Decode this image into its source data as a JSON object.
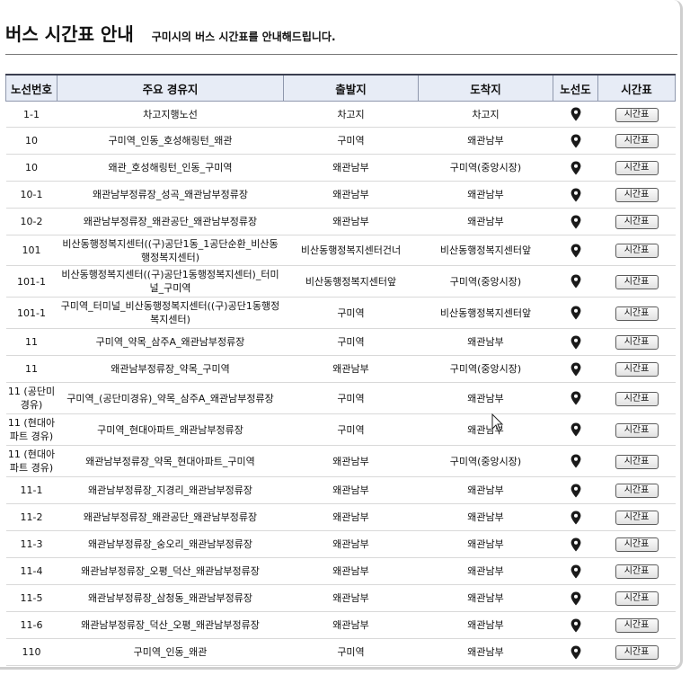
{
  "header": {
    "title": "버스 시간표 안내",
    "subtitle": "구미시의 버스 시간표를 안내해드립니다."
  },
  "table": {
    "columns": [
      "노선번호",
      "주요 경유지",
      "출발지",
      "도착지",
      "노선도",
      "시간표"
    ],
    "button_label": "시간표",
    "rows": [
      {
        "route": "1-1",
        "via": "차고지행노선",
        "from": "차고지",
        "to": "차고지",
        "h": 29
      },
      {
        "route": "10",
        "via": "구미역_인동_호성해링턴_왜관",
        "from": "구미역",
        "to": "왜관남부",
        "h": 30
      },
      {
        "route": "10",
        "via": "왜관_호성해링턴_인동_구미역",
        "from": "왜관남부",
        "to": "구미역(중앙시장)",
        "h": 30
      },
      {
        "route": "10-1",
        "via": "왜관남부정류장_성곡_왜관남부정류장",
        "from": "왜관남부",
        "to": "왜관남부",
        "h": 30
      },
      {
        "route": "10-2",
        "via": "왜관남부정류장_왜관공단_왜관남부정류장",
        "from": "왜관남부",
        "to": "왜관남부",
        "h": 30
      },
      {
        "route": "101",
        "via": "비산동행정복지센터((구)공단1동_1공단순환_비산동행정복지센터)",
        "from": "비산동행정복지센터건너",
        "to": "비산동행정복지센터앞",
        "h": 34
      },
      {
        "route": "101-1",
        "via": "비산동행정복지센터((구)공단1동행정복지센터)_터미널_구미역",
        "from": "비산동행정복지센터앞",
        "to": "구미역(중앙시장)",
        "h": 35
      },
      {
        "route": "101-1",
        "via": "구미역_터미널_비산동행정복지센터((구)공단1동행정복지센터)",
        "from": "구미역",
        "to": "비산동행정복지센터앞",
        "h": 35
      },
      {
        "route": "11",
        "via": "구미역_약목_삼주A_왜관남부정류장",
        "from": "구미역",
        "to": "왜관남부",
        "h": 30
      },
      {
        "route": "11",
        "via": "왜관남부정류장_약목_구미역",
        "from": "왜관남부",
        "to": "구미역(중앙시장)",
        "h": 30
      },
      {
        "route": "11 (공단미경유)",
        "via": "구미역_(공단미경유)_약목_삼주A_왜관남부정류장",
        "from": "구미역",
        "to": "왜관남부",
        "h": 35
      },
      {
        "route": "11 (현대아파트 경유)",
        "via": "구미역_현대아파트_왜관남부정류장",
        "from": "구미역",
        "to": "왜관남부",
        "h": 35
      },
      {
        "route": "11 (현대아파트 경유)",
        "via": "왜관남부정류장_약목_현대아파트_구미역",
        "from": "왜관남부",
        "to": "구미역(중앙시장)",
        "h": 35
      },
      {
        "route": "11-1",
        "via": "왜관남부정류장_지경리_왜관남부정류장",
        "from": "왜관남부",
        "to": "왜관남부",
        "h": 30
      },
      {
        "route": "11-2",
        "via": "왜관남부정류장_왜관공단_왜관남부정류장",
        "from": "왜관남부",
        "to": "왜관남부",
        "h": 30
      },
      {
        "route": "11-3",
        "via": "왜관남부정류장_숭오리_왜관남부정류장",
        "from": "왜관남부",
        "to": "왜관남부",
        "h": 30
      },
      {
        "route": "11-4",
        "via": "왜관남부정류장_오평_덕산_왜관남부정류장",
        "from": "왜관남부",
        "to": "왜관남부",
        "h": 30
      },
      {
        "route": "11-5",
        "via": "왜관남부정류장_삼청동_왜관남부정류장",
        "from": "왜관남부",
        "to": "왜관남부",
        "h": 30
      },
      {
        "route": "11-6",
        "via": "왜관남부정류장_덕산_오평_왜관남부정류장",
        "from": "왜관남부",
        "to": "왜관남부",
        "h": 30
      },
      {
        "route": "110",
        "via": "구미역_인동_왜관",
        "from": "구미역",
        "to": "왜관남부",
        "h": 30
      }
    ]
  },
  "icons": {
    "map": "map-pin-icon",
    "cursor": "mouse-cursor-icon"
  }
}
